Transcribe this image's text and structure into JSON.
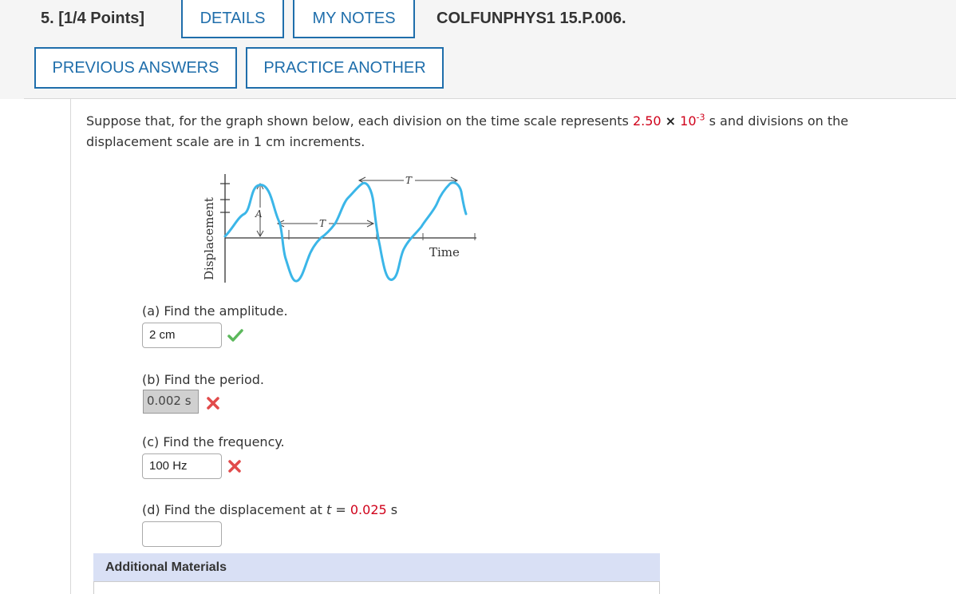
{
  "header": {
    "question_number": "5. [1/4 Points]",
    "details_label": "DETAILS",
    "my_notes_label": "MY NOTES",
    "question_id": "COLFUNPHYS1 15.P.006.",
    "previous_answers_label": "PREVIOUS ANSWERS",
    "practice_another_label": "PRACTICE ANOTHER"
  },
  "problem": {
    "text_1": "Suppose that, for the graph shown below, each division on the time scale represents ",
    "value": "2.50",
    "times": "×",
    "base": "10",
    "exponent": "-3",
    "text_2": " s and divisions on the displacement scale are in 1 cm increments."
  },
  "graph": {
    "ylabel": "Displacement",
    "xlabel": "Time",
    "label_A": "A",
    "label_T": "T",
    "wave_color": "#3bb6e8"
  },
  "parts": {
    "a": {
      "label": "(a) Find the amplitude.",
      "answer": "2 cm",
      "status": "correct"
    },
    "b": {
      "label": "(b) Find the period.",
      "answer": "0.002 s",
      "status": "incorrect"
    },
    "c": {
      "label": "(c) Find the frequency.",
      "answer": "100 Hz",
      "status": "incorrect"
    },
    "d": {
      "label_prefix": "(d) Find the displacement at ",
      "var": "t",
      "equals": " = ",
      "value": "0.025",
      "unit": " s",
      "answer": ""
    }
  },
  "additional_materials": {
    "label": "Additional Materials"
  },
  "colors": {
    "accent": "#1f6eab",
    "error": "#d0021b",
    "correct": "#5cb85c",
    "wave": "#3bb6e8"
  }
}
